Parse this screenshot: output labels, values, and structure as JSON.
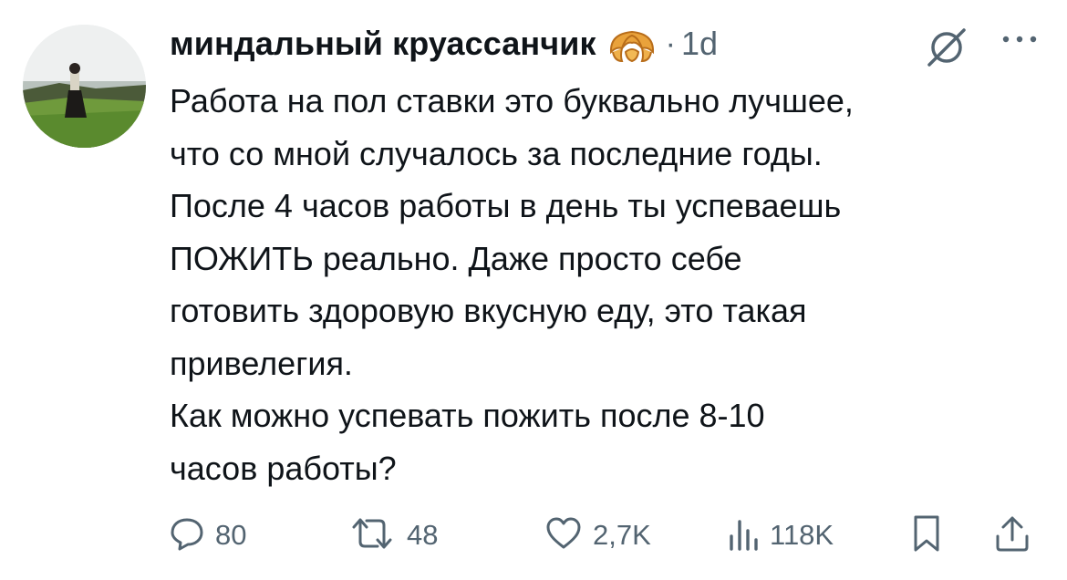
{
  "author": {
    "name": "миндальный круассанчик",
    "emoji_icon": "croissant-icon",
    "separator": "·",
    "time": "1d"
  },
  "tweet": {
    "lines": [
      "Работа на пол ставки это буквально лучшее,",
      "что со мной случалось за последние годы.",
      "После 4 часов работы в день ты успеваешь",
      "ПОЖИТЬ реально. Даже просто себе",
      "готовить здоровую вкусную еду, это такая",
      "привелегия.",
      "Как можно успевать пожить после 8-10",
      "часов работы?"
    ]
  },
  "actions": {
    "replies": "80",
    "reposts": "48",
    "likes": "2,7K",
    "views": "118K"
  },
  "colors": {
    "text": "#0f1419",
    "muted": "#536471",
    "croissant": "#e9a23b"
  }
}
